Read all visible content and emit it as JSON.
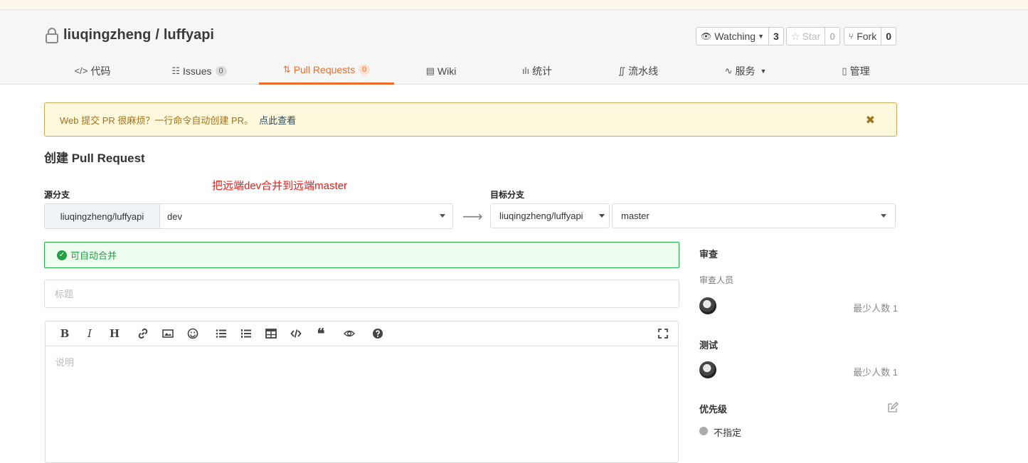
{
  "repo": {
    "owner": "liuqingzheng",
    "name": "luffyapi",
    "separator": "/"
  },
  "actions": {
    "watch": {
      "label": "Watching",
      "count": "3"
    },
    "star": {
      "label": "Star",
      "count": "0"
    },
    "fork": {
      "label": "Fork",
      "count": "0"
    }
  },
  "tabs": [
    {
      "label": "代码",
      "icon": "code-icon"
    },
    {
      "label": "Issues",
      "count": "0",
      "icon": "issues-icon"
    },
    {
      "label": "Pull Requests",
      "count": "0",
      "icon": "pull-request-icon",
      "active": true
    },
    {
      "label": "Wiki",
      "icon": "book-icon"
    },
    {
      "label": "统计",
      "icon": "bar-chart-icon"
    },
    {
      "label": "流水线",
      "icon": "pipeline-icon"
    },
    {
      "label": "服务",
      "icon": "pulse-icon"
    },
    {
      "label": "管理",
      "icon": "document-icon"
    }
  ],
  "alert": {
    "text": "Web 提交 PR 很麻烦？一行命令自动创建 PR。",
    "link": "点此查看",
    "close": "✖"
  },
  "page_title": "创建 Pull Request",
  "annotation": "把远端dev合并到远端master",
  "source": {
    "label": "源分支",
    "owner": "liuqingzheng/luffyapi",
    "branch": "dev"
  },
  "target": {
    "label": "目标分支",
    "owner": "liuqingzheng/luffyapi",
    "branch": "master"
  },
  "arrow": "⟶",
  "merge_status": "可自动合并",
  "form": {
    "title_placeholder": "标题",
    "description_placeholder": "说明"
  },
  "toolbar_icons": [
    "bold-icon",
    "italic-icon",
    "heading-icon",
    "link-icon",
    "image-icon",
    "emoji-icon",
    "bullet-list-icon",
    "numbered-list-icon",
    "table-icon",
    "code-icon",
    "quote-icon",
    "preview-icon",
    "help-icon",
    "fullscreen-icon"
  ],
  "sidebar": {
    "review_heading": "审查",
    "reviewers_label": "审查人员",
    "reviewers_min": "最少人数 1",
    "test_heading": "测试",
    "testers_min": "最少人数 1",
    "priority_heading": "优先级",
    "priority_value": "不指定"
  },
  "colors": {
    "accent": "#f06d2a",
    "success": "#21a044",
    "annotation": "#e2211c",
    "alert_bg": "#fef8dc"
  }
}
